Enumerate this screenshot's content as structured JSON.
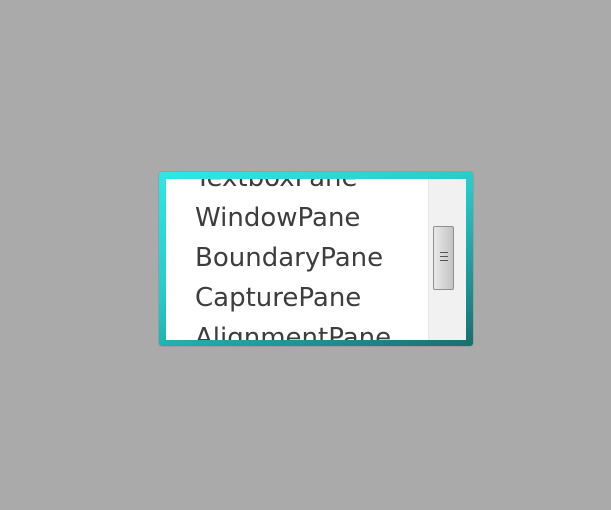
{
  "listbox": {
    "items": [
      "TextboxPane",
      "WindowPane",
      "BoundaryPane",
      "CapturePane",
      "AlignmentPane"
    ]
  },
  "colors": {
    "background": "#aaaaaa",
    "frame_accent": "#2de8e8",
    "frame_dark": "#1a6d6d",
    "item_text": "#3d3d3d"
  },
  "icons": {
    "scroll_thumb_grip": "grip-lines-icon"
  }
}
